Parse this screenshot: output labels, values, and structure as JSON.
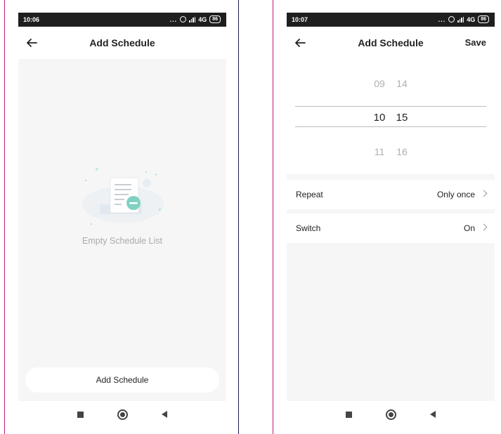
{
  "left": {
    "status": {
      "time": "10:06",
      "dots": "...",
      "network": "4G",
      "battery": "86"
    },
    "header": {
      "title": "Add Schedule"
    },
    "empty": {
      "text": "Empty Schedule List"
    },
    "add_button": "Add Schedule"
  },
  "right": {
    "status": {
      "time": "10:07",
      "dots": "...",
      "network": "4G",
      "battery": "86"
    },
    "header": {
      "title": "Add Schedule",
      "save": "Save"
    },
    "picker": {
      "hours": [
        "09",
        "10",
        "11"
      ],
      "minutes": [
        "14",
        "15",
        "16"
      ]
    },
    "settings": [
      {
        "label": "Repeat",
        "value": "Only once"
      },
      {
        "label": "Switch",
        "value": "On"
      }
    ]
  },
  "icons": [
    "back-arrow-icon",
    "alarm-icon",
    "signal-icon",
    "battery-icon",
    "chevron-right-icon",
    "recents-icon",
    "home-icon",
    "nav-back-icon"
  ],
  "colors": {
    "accent": "#7fd1c2",
    "frame_left": "#c2187a",
    "frame_right": "#1d1d5e",
    "background": "#f6f6f6"
  }
}
